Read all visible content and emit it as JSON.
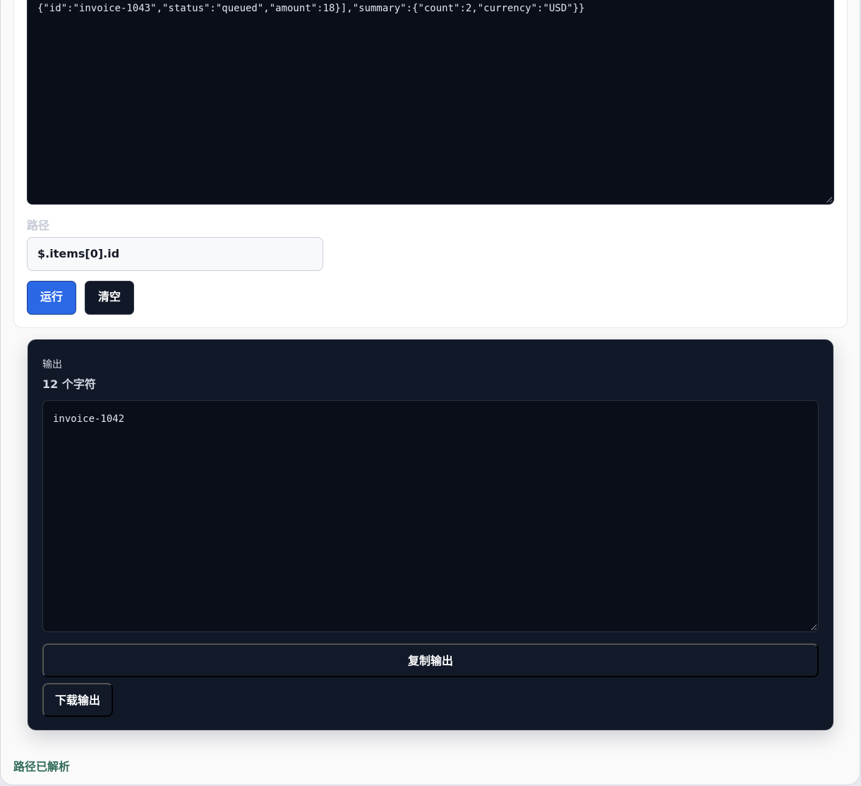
{
  "input": {
    "json_visible_line": "{\"id\":\"invoice-1043\",\"status\":\"queued\",\"amount\":18}],\"summary\":{\"count\":2,\"currency\":\"USD\"}}"
  },
  "path": {
    "label": "路径",
    "value": "$.items[0].id"
  },
  "actions": {
    "run_label": "运行",
    "clear_label": "清空"
  },
  "output": {
    "title": "输出",
    "count_text": "12 个字符",
    "value": "invoice-1042",
    "copy_label": "复制输出",
    "download_label": "下载输出"
  },
  "status": {
    "message": "路径已解析"
  },
  "colors": {
    "run_button": "#2b68e6",
    "clear_button": "#111827",
    "output_panel": "#111827",
    "code_background": "#0a0e19",
    "status_text": "#2f6a5a"
  }
}
